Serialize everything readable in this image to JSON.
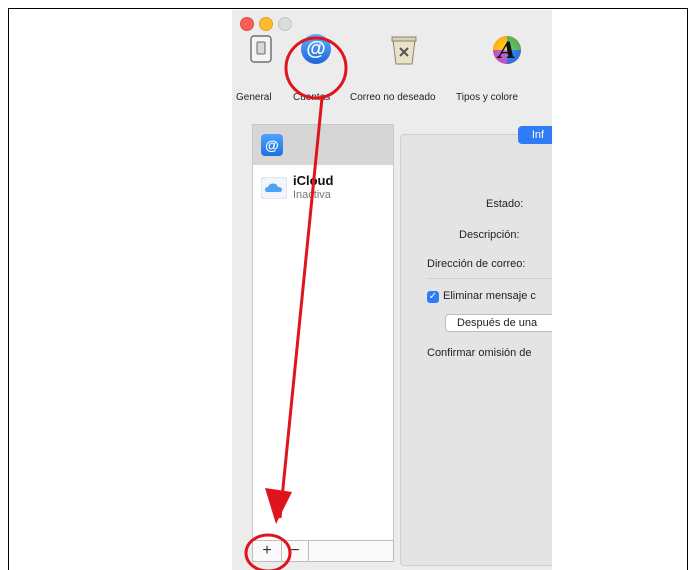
{
  "toolbar": {
    "items": [
      {
        "label": "General",
        "icon": "switch-icon"
      },
      {
        "label": "Cuentas",
        "icon": "at-icon"
      },
      {
        "label": "Correo no deseado",
        "icon": "junk-bin-icon"
      },
      {
        "label": "Tipos y colore",
        "icon": "fonts-colors-icon"
      }
    ]
  },
  "accounts": {
    "selected_icon": "@",
    "items": [
      {
        "name": "iCloud",
        "status": "Inactiva",
        "icon": "icloud-icon"
      }
    ]
  },
  "detail": {
    "tab_label": "Inf",
    "estado_label": "Estado:",
    "descripcion_label": "Descripción:",
    "direccion_label": "Dirección de correo:",
    "eliminar_label": "Eliminar mensaje c",
    "eliminar_checked": true,
    "despues_value": "Después de una",
    "confirmar_label": "Confirmar omisión de"
  },
  "list_buttons": {
    "add": "+",
    "remove": "−"
  },
  "annotation_color": "#e0141c"
}
